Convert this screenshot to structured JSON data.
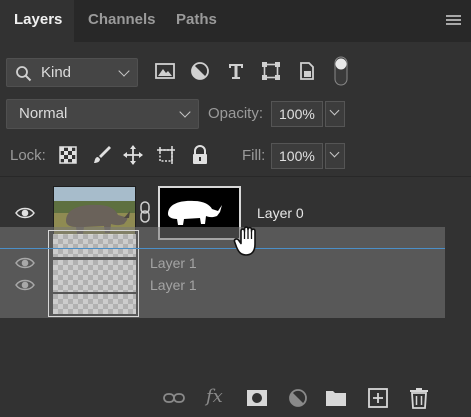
{
  "tabs": [
    {
      "label": "Layers",
      "active": true
    },
    {
      "label": "Channels",
      "active": false
    },
    {
      "label": "Paths",
      "active": false
    }
  ],
  "filter": {
    "kind_label": "Kind",
    "icons": [
      "image-filter-icon",
      "adjustment-filter-icon",
      "type-filter-icon",
      "shape-filter-icon",
      "smart-object-filter-icon",
      "filter-toggle-switch"
    ]
  },
  "blend": {
    "mode": "Normal",
    "opacity_label": "Opacity:",
    "opacity_value": "100%"
  },
  "lock": {
    "label": "Lock:",
    "icons": [
      "lock-transparent-pixels-icon",
      "lock-image-pixels-icon",
      "lock-position-icon",
      "prevent-autonest-icon",
      "lock-all-icon"
    ],
    "fill_label": "Fill:",
    "fill_value": "100%"
  },
  "layers": [
    {
      "name": "Layer 0",
      "visible": true,
      "has_mask": true,
      "linked": true,
      "thumbnail": "rhinoceros-photo"
    }
  ],
  "drag_ghost": {
    "names": [
      "Layer 1",
      "Layer 1"
    ]
  },
  "bottom_toolbar": {
    "icons": [
      "link-layers-icon",
      "fx-icon",
      "add-mask-icon",
      "adjustment-layer-icon",
      "new-group-icon",
      "new-layer-icon",
      "delete-icon"
    ],
    "fx_label": "fx"
  },
  "colors": {
    "panel_bg": "#323232",
    "tab_bar_bg": "#282828",
    "drop_indicator": "#4b8fc8"
  }
}
